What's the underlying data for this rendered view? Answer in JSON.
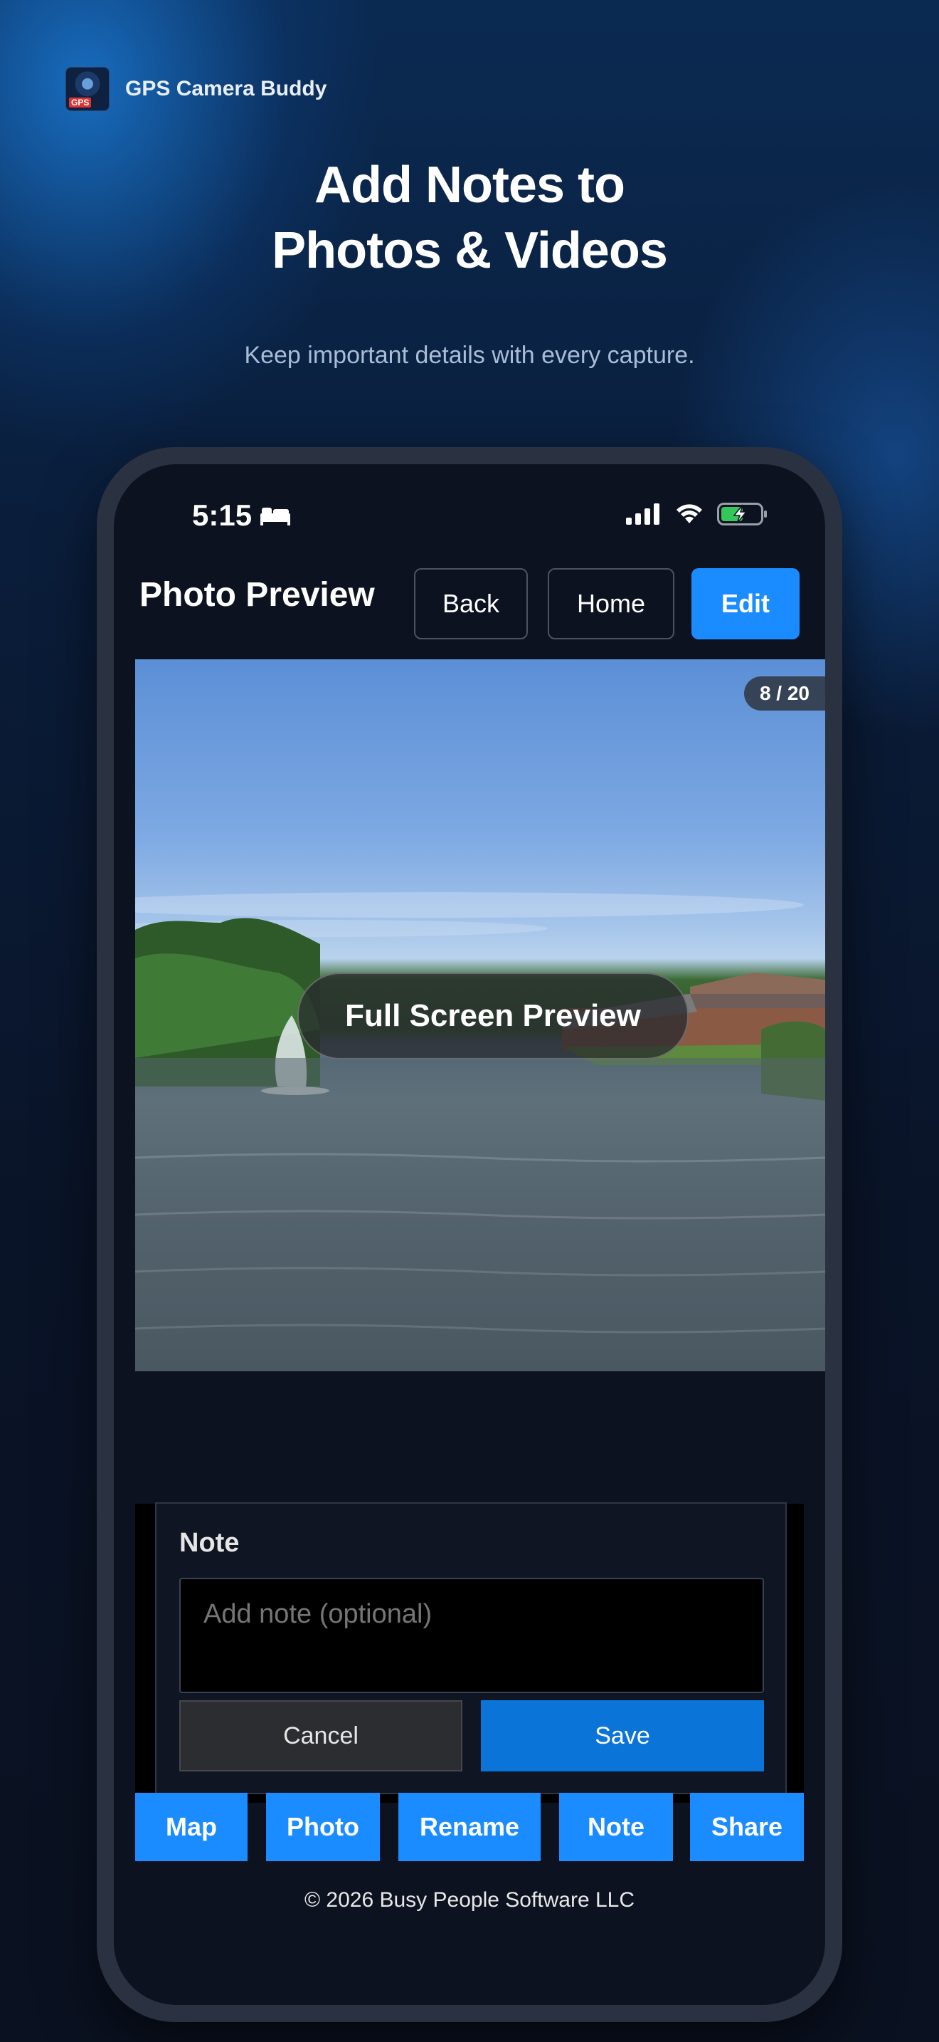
{
  "brand": {
    "name": "GPS Camera Buddy",
    "logo_tag": "GPS",
    "logo_icon": "app-logo-icon"
  },
  "headline": {
    "line1": "Add Notes to",
    "line2": "Photos & Videos"
  },
  "subhead": "Keep important details with every capture.",
  "status_bar": {
    "time": "5:15",
    "icons": [
      "bed-icon",
      "signal-icon",
      "wifi-icon",
      "battery-charging-icon"
    ],
    "battery_color": "#34c759"
  },
  "header": {
    "title": "Photo Preview",
    "back_label": "Back",
    "home_label": "Home",
    "edit_label": "Edit"
  },
  "preview": {
    "counter": "8 / 20",
    "fullscreen_label": "Full Screen Preview"
  },
  "note": {
    "label": "Note",
    "placeholder": "Add note (optional)",
    "cancel_label": "Cancel",
    "save_label": "Save"
  },
  "actions": [
    {
      "label": "Map"
    },
    {
      "label": "Photo"
    },
    {
      "label": "Rename"
    },
    {
      "label": "Note"
    },
    {
      "label": "Share"
    }
  ],
  "footer": {
    "copyright": "© 2026 Busy People Software LLC"
  },
  "colors": {
    "accent": "#1a8cff",
    "save": "#0a74d8",
    "background": "#0a1428"
  }
}
